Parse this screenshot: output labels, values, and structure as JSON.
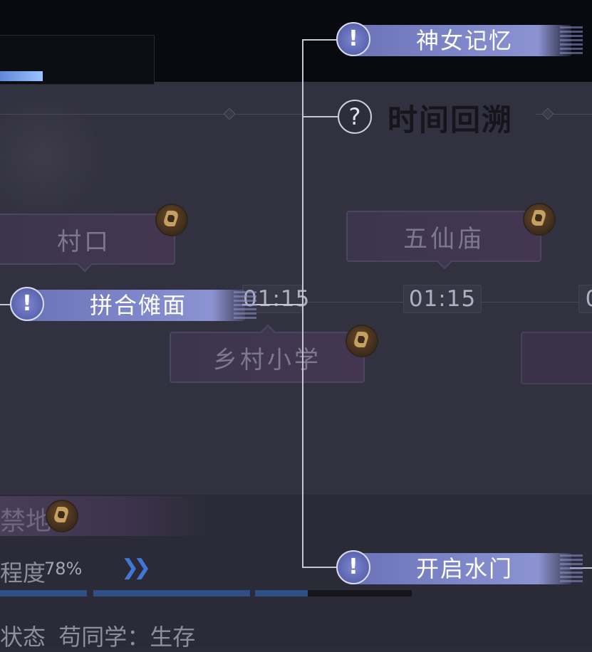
{
  "chapter": {
    "title": "时间回溯",
    "help_icon": "question-circle-icon"
  },
  "event_nodes": [
    {
      "id": "shennv",
      "label": "神女记忆",
      "icon": "exclamation-icon"
    },
    {
      "id": "pinhe",
      "label": "拼合傩面",
      "icon": "exclamation-icon"
    },
    {
      "id": "kaiqi",
      "label": "开启水门",
      "icon": "exclamation-icon"
    }
  ],
  "locations": [
    {
      "name": "村口",
      "badge": "leaf-emblem-icon"
    },
    {
      "name": "五仙庙",
      "badge": "leaf-emblem-icon"
    },
    {
      "name": "乡村小学",
      "badge": "leaf-emblem-icon"
    }
  ],
  "timestamps": {
    "left": "01:15",
    "middle": "01:15",
    "right": "0"
  },
  "info": {
    "forbidden_label": "禁地",
    "progress_label": "程度",
    "progress_value": "78%",
    "progress_fraction": 0.78,
    "status_label": "状态",
    "status_value": "苟同学：生存"
  },
  "colors": {
    "accent": "#7c84c8",
    "progress": "#2f4e86",
    "badge": "#c5a060"
  }
}
